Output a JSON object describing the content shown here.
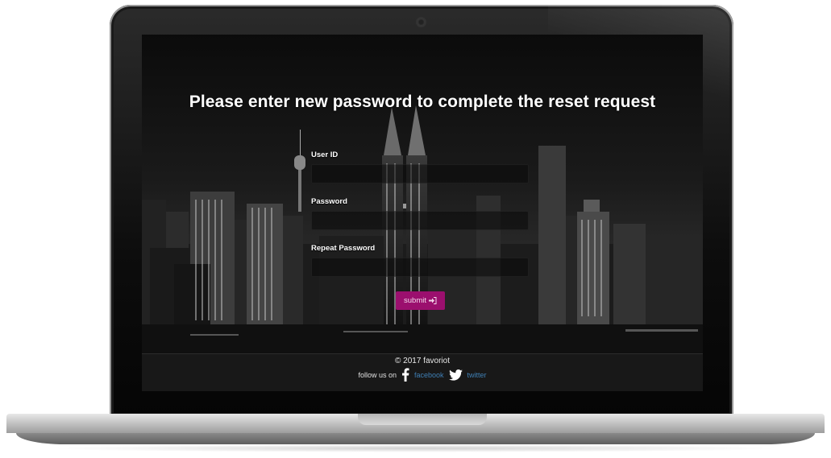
{
  "headline": "Please enter new password to complete the reset request",
  "form": {
    "user_id_label": "User ID",
    "password_label": "Password",
    "repeat_password_label": "Repeat Password",
    "user_id_value": "",
    "password_value": "",
    "repeat_password_value": "",
    "submit_label": "submit"
  },
  "footer": {
    "copyright": "© 2017 favoriot",
    "follow_text": "follow us on",
    "facebook_label": "facebook",
    "twitter_label": "twitter"
  },
  "icons": {
    "submit_icon": "sign-in-icon",
    "facebook_icon": "facebook-icon",
    "twitter_icon": "twitter-icon"
  },
  "colors": {
    "accent": "#9b0f6e",
    "link": "#3f7fb4",
    "background": "#000000"
  }
}
